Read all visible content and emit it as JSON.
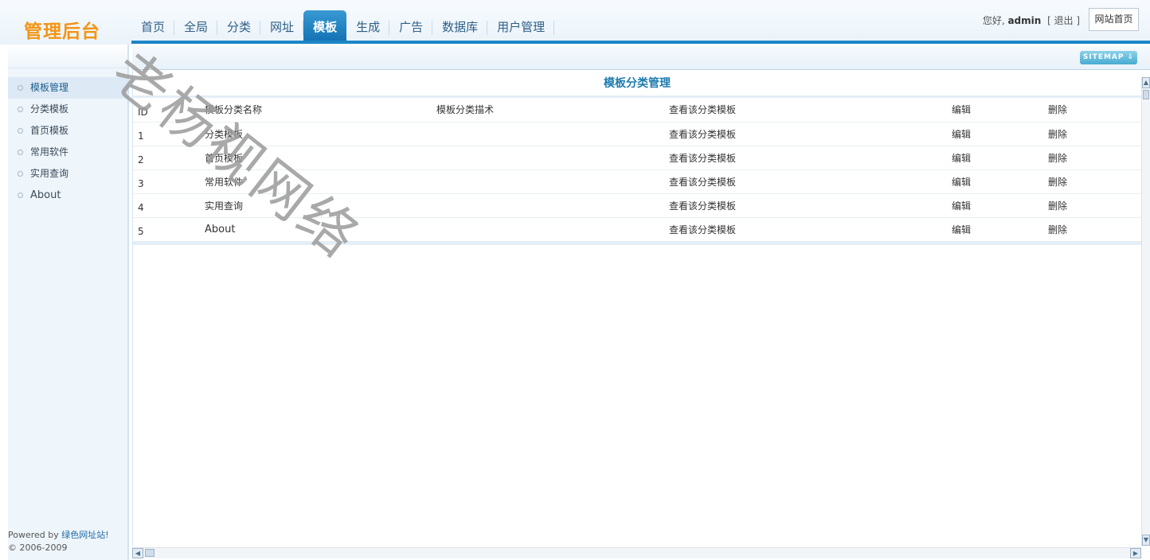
{
  "header": {
    "logo": "管理后台",
    "nav": [
      "首页",
      "全局",
      "分类",
      "网址",
      "模板",
      "生成",
      "广告",
      "数据库",
      "用户管理"
    ],
    "active_nav": "模板",
    "greeting": "您好, ",
    "username": "admin",
    "logout_open": "[",
    "logout_label": "退出",
    "logout_close": "]",
    "site_home": "网站首页"
  },
  "subheader": {
    "sitemap": "SITEMAP ⇩"
  },
  "sidebar": {
    "items": [
      "模板管理",
      "分类模板",
      "首页模板",
      "常用软件",
      "实用查询",
      "About"
    ],
    "active": "模板管理",
    "powered_prefix": "Powered by ",
    "powered_link": "绿色网址站",
    "powered_suffix": "!",
    "copyright": "© 2006-2009"
  },
  "panel": {
    "title": "模板分类管理",
    "columns": {
      "id": "ID",
      "name": "模板分类名称",
      "desc": "模板分类描术",
      "view": "查看该分类模板",
      "edit": "编辑",
      "del": "删除"
    },
    "rows": [
      {
        "id": "1",
        "name": "分类模板",
        "desc": "",
        "view": "查看该分类模板",
        "edit": "编辑",
        "del": "删除"
      },
      {
        "id": "2",
        "name": "首页模板",
        "desc": "",
        "view": "查看该分类模板",
        "edit": "编辑",
        "del": "删除"
      },
      {
        "id": "3",
        "name": "常用软件",
        "desc": "",
        "view": "查看该分类模板",
        "edit": "编辑",
        "del": "删除"
      },
      {
        "id": "4",
        "name": "实用查询",
        "desc": "",
        "view": "查看该分类模板",
        "edit": "编辑",
        "del": "删除"
      },
      {
        "id": "5",
        "name": "About",
        "desc": "",
        "view": "查看该分类模板",
        "edit": "编辑",
        "del": "删除"
      }
    ]
  },
  "scrollbars": {
    "up": "▲",
    "down": "▼",
    "left": "◀",
    "right": "▶"
  },
  "watermark_text": "老杨视网络",
  "colors": {
    "logo": "#f39515",
    "accent": "#1b86c6",
    "link_green": "#5c8f14",
    "link_blue": "#275f8e"
  }
}
